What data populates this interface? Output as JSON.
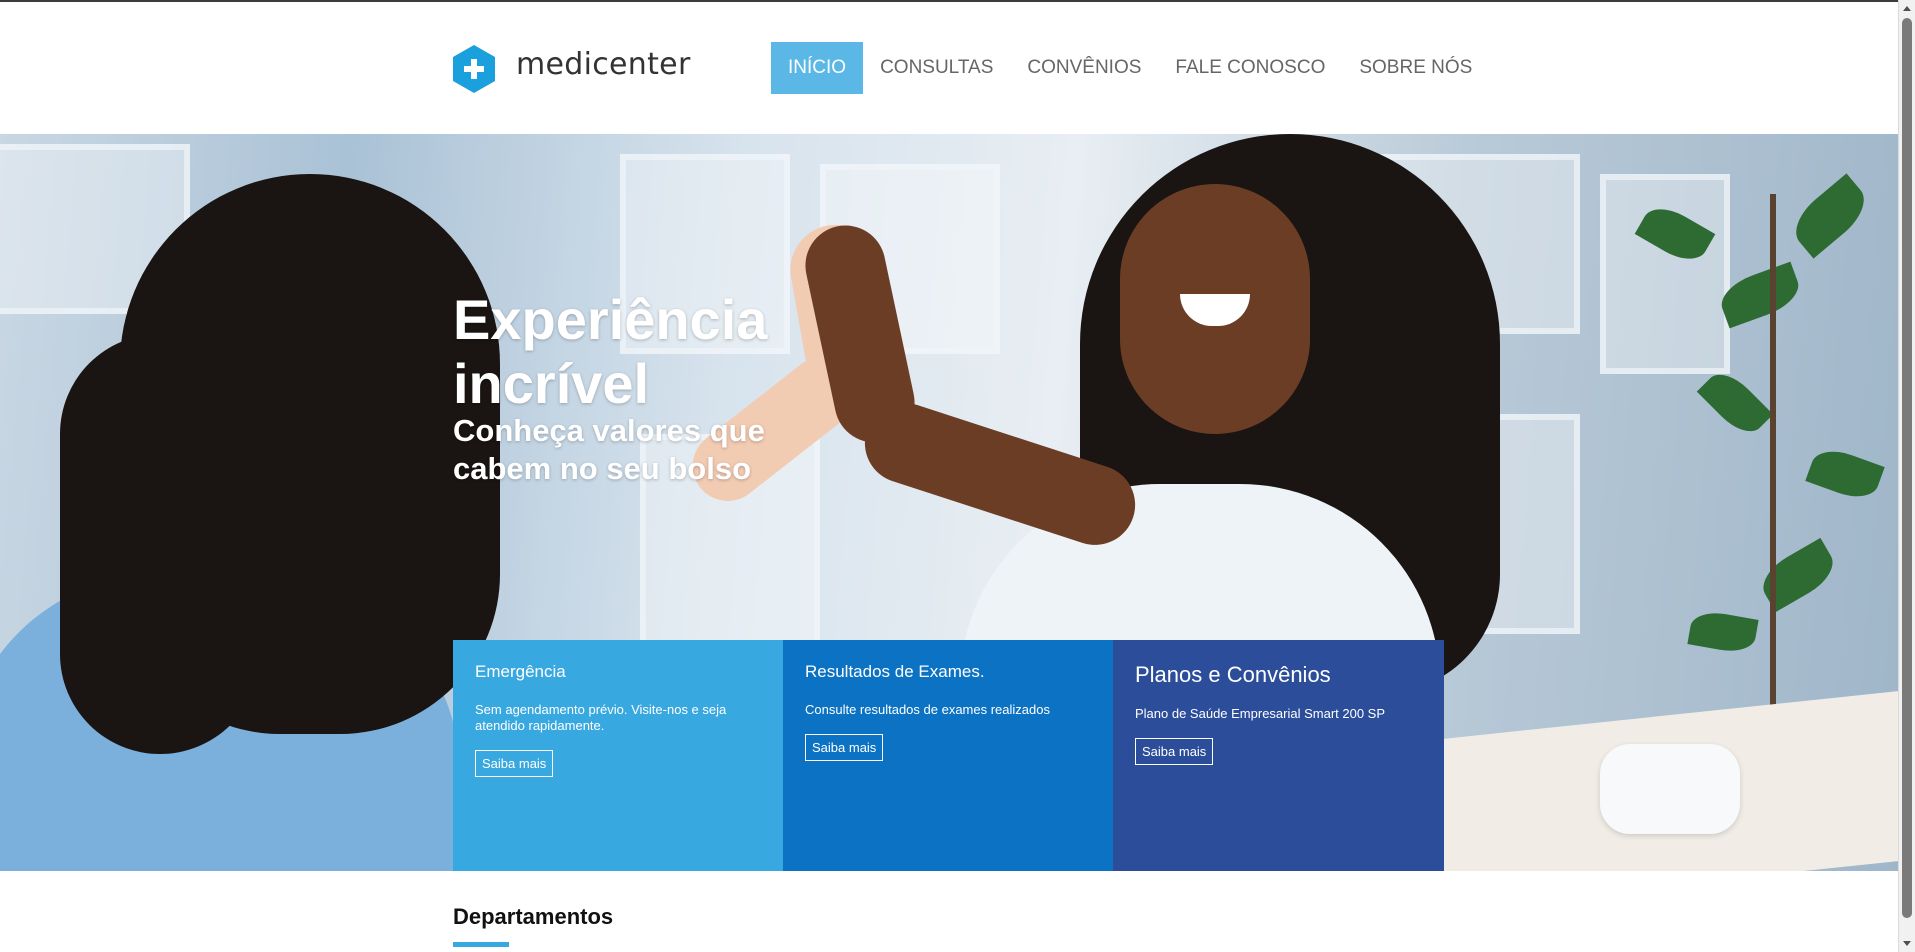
{
  "brand": {
    "name": "medicenter",
    "color": "#1aa0dc",
    "icon": "plus-hexagon-icon"
  },
  "nav": {
    "items": [
      {
        "label": "INÍCIO",
        "active": true
      },
      {
        "label": "CONSULTAS",
        "active": false
      },
      {
        "label": "CONVÊNIOS",
        "active": false
      },
      {
        "label": "FALE CONOSCO",
        "active": false
      },
      {
        "label": "SOBRE NÓS",
        "active": false
      }
    ],
    "active_color": "#5bb8e6"
  },
  "hero": {
    "title": "Experiência incrível",
    "subtitle": "Conheça valores que cabem no seu bolso"
  },
  "cards": [
    {
      "title": "Emergência",
      "text": "Sem agendamento prévio. Visite-nos e seja atendido rapidamente.",
      "button": "Saiba mais",
      "color": "#38a8e0"
    },
    {
      "title": "Resultados de Exames.",
      "text": "Consulte resultados de exames realizados",
      "button": "Saiba mais",
      "color": "#0b72c4"
    },
    {
      "title": "Planos e Convênios",
      "text": "Plano de Saúde Empresarial Smart 200 SP",
      "button": "Saiba mais",
      "color": "#2b4d9a"
    }
  ],
  "departments": {
    "title": "Departamentos"
  }
}
